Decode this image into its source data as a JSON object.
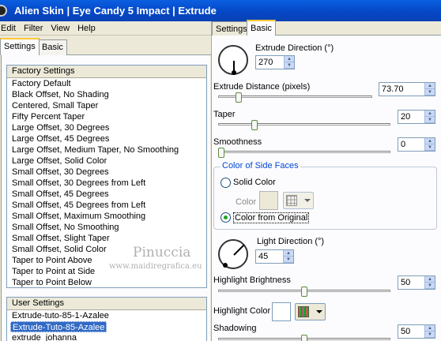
{
  "title": "Alien Skin | Eye Candy 5 Impact | Extrude",
  "menu": [
    "Edit",
    "Filter",
    "View",
    "Help"
  ],
  "left_tabs": {
    "settings": "Settings",
    "basic": "Basic"
  },
  "factory": {
    "header": "Factory Settings",
    "items": [
      "Factory Default",
      "Black Offset, No Shading",
      "Centered, Small Taper",
      "Fifty Percent Taper",
      "Large Offset, 30 Degrees",
      "Large Offset, 45 Degrees",
      "Large Offset, Medium Taper, No Smoothing",
      "Large Offset, Solid Color",
      "Small Offset, 30 Degrees",
      "Small Offset, 30 Degrees from Left",
      "Small Offset, 45 Degrees",
      "Small Offset, 45 Degrees from Left",
      "Small Offset, Maximum Smoothing",
      "Small Offset, No Smoothing",
      "Small Offset, Slight Taper",
      "Small Offset, Solid Color",
      "Taper to Point Above",
      "Taper to Point at Side",
      "Taper to Point Below"
    ]
  },
  "user": {
    "header": "User Settings",
    "items": [
      "Extrude-tuto-85-1-Azalee",
      "Extrude-Tuto-85-Azalee",
      "extrude_johanna"
    ],
    "selected_index": 1
  },
  "right_tabs": {
    "settings": "Settings",
    "basic": "Basic"
  },
  "extrude_direction": {
    "label": "Extrude Direction (°)",
    "value": "270"
  },
  "extrude_distance": {
    "label": "Extrude Distance (pixels)",
    "value": "73.70",
    "level": 0.12
  },
  "taper": {
    "label": "Taper",
    "value": "20",
    "level": 0.2
  },
  "smoothness": {
    "label": "Smoothness",
    "value": "0",
    "level": 0.0
  },
  "side_faces": {
    "legend": "Color of Side Faces",
    "solid_color": "Solid Color",
    "color_label": "Color",
    "from_original": "Color from Original",
    "selected": "from_original"
  },
  "light_direction": {
    "label": "Light Direction (°)",
    "value": "45"
  },
  "highlight_brightness": {
    "label": "Highlight Brightness",
    "value": "50",
    "level": 0.5
  },
  "highlight_color": {
    "label": "Highlight Color",
    "swatch": "#ffffff"
  },
  "shadowing": {
    "label": "Shadowing",
    "value": "50",
    "level": 0.5
  },
  "watermark": {
    "line1": "Pinuccia",
    "line2": "www.maidiregrafica.eu"
  },
  "colors": {
    "titlebar": "#0a5fe0",
    "selection": "#316ac5",
    "face": "#ece9d8",
    "group_blue": "#0046d5"
  },
  "icons": [
    "app-icon",
    "palette-grid-icon",
    "dropdown-arrow-icon",
    "spin-up-icon",
    "spin-down-icon"
  ]
}
